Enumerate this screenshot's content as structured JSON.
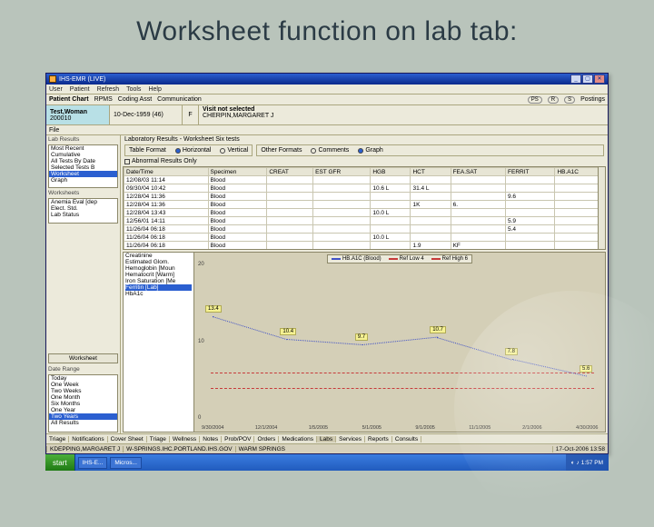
{
  "slide_title": "Worksheet function on lab tab:",
  "window": {
    "title": "IHS-EMR (LIVE)"
  },
  "menubar": [
    "User",
    "Patient",
    "Refresh",
    "Tools",
    "Help"
  ],
  "toolstrip": {
    "label": "Patient Chart",
    "items": [
      "RPMS",
      "Coding Asst",
      "Communication"
    ],
    "right": [
      "PS",
      "R",
      "S",
      "Postings"
    ]
  },
  "patient": {
    "name": "Test,Woman",
    "mrn": "200010",
    "dob": "10-Dec-1959 (46)",
    "sex": "F",
    "visit_label": "Visit not selected",
    "provider": "CHERPIN,MARGARET J"
  },
  "file_menu": "File",
  "left": {
    "views_label": "Lab Results",
    "views": [
      "Most Recent",
      "Cumulative",
      "All Tests By Date",
      "Selected Tests B",
      "Worksheet",
      "Graph"
    ],
    "views_sel": 4,
    "testgroups_label": "Worksheets",
    "testgroups": [
      "Anemia Eval [dep",
      "Elect. Std.",
      "Lab Status"
    ],
    "date_label": "Date Range",
    "dates": [
      "Today",
      "One Week",
      "Two Weeks",
      "One Month",
      "Six Months",
      "One Year",
      "Two Years",
      "All Results"
    ],
    "dates_sel": 6,
    "btn_worksheet": "Worksheet"
  },
  "ws": {
    "title": "Laboratory Results - Worksheet   Six tests",
    "tableformat_label": "Table Format",
    "tf_options": [
      "Horizontal",
      "Vertical"
    ],
    "tf_sel": 0,
    "otherformat_label": "Other Formats",
    "of_options": [
      "Comments",
      "Graph"
    ],
    "of_sel": 1,
    "chk_abn": "Abnormal Results Only"
  },
  "grid": {
    "cols": [
      "Date/Time",
      "Specimen",
      "CREAT",
      "EST GFR",
      "HGB",
      "HCT",
      "FEA.SAT",
      "FERRIT",
      "HB.A1C"
    ],
    "rows": [
      [
        "12/08/03 11:14",
        "Blood",
        "",
        "",
        "",
        "",
        "",
        "",
        ""
      ],
      [
        "09/30/04 10:42",
        "Blood",
        "",
        "",
        "10.6 L",
        "31.4 L",
        "",
        "",
        ""
      ],
      [
        "12/28/04 11:36",
        "Blood",
        "",
        "",
        "",
        "",
        "",
        "9.6",
        ""
      ],
      [
        "12/28/04 11:36",
        "Blood",
        "",
        "",
        "",
        "1K",
        "6.",
        "",
        ""
      ],
      [
        "12/28/04 13:43",
        "Blood",
        "",
        "",
        "10.0 L",
        "",
        "",
        "",
        ""
      ],
      [
        "12/56/01 14:11",
        "Blood",
        "",
        "",
        "",
        "",
        "",
        "5.9",
        ""
      ],
      [
        "11/26/04 06:18",
        "Blood",
        "",
        "",
        "",
        "",
        "",
        "5.4",
        ""
      ],
      [
        "11/26/04 06:18",
        "Blood",
        "",
        "",
        "10.0 L",
        "",
        "",
        "",
        ""
      ],
      [
        "11/26/04 06:18",
        "Blood",
        "",
        "",
        "",
        "1.9",
        "KF",
        "",
        ""
      ]
    ]
  },
  "graph_side": [
    "Creatinine",
    "Estimated Glom.",
    "Hemoglobin [Moun",
    "Hematocrit [Warm]",
    "Iron Saturation [Me",
    "Ferritin [Lab]",
    "HbA1c"
  ],
  "graph_side_sel": 5,
  "chart_data": {
    "type": "line",
    "title": "",
    "yticks": [
      0,
      10,
      20
    ],
    "x_ticks": [
      "9/30/2004",
      "12/1/2004",
      "1/5/2005",
      "5/1/2005",
      "9/1/2005",
      "11/1/2005",
      "2/1/2006",
      "4/30/2006"
    ],
    "series": [
      {
        "name": "HB.A1C (Blood)",
        "kind": "data",
        "values": [
          13.4,
          10.4,
          9.7,
          10.7,
          7.8,
          5.6
        ]
      },
      {
        "name": "Ref Low 4",
        "kind": "ref",
        "value": 4
      },
      {
        "name": "Ref High 6",
        "kind": "ref",
        "value": 6
      }
    ],
    "point_labels": [
      "13.4",
      "10.4",
      "9.7",
      "10.7",
      "7.8",
      "5.6"
    ]
  },
  "tabs": [
    "Triage",
    "Notifications",
    "Cover Sheet",
    "Triage",
    "Wellness",
    "Notes",
    "Prob/POV",
    "Orders",
    "Medications",
    "Labs",
    "Services",
    "Reports",
    "Consults"
  ],
  "tabs_on": 9,
  "statusbar": [
    "KDEPPING,MARGARET J",
    "W-SPRINGS.IHC.PORTLAND.IHS.GOV",
    "WARM SPRINGS",
    "17-Oct-2006 13:58"
  ],
  "taskbar": {
    "start": "start",
    "tasks": [
      "",
      "",
      "",
      "IHS-E...",
      "Micros..."
    ],
    "time": "1:57 PM"
  }
}
